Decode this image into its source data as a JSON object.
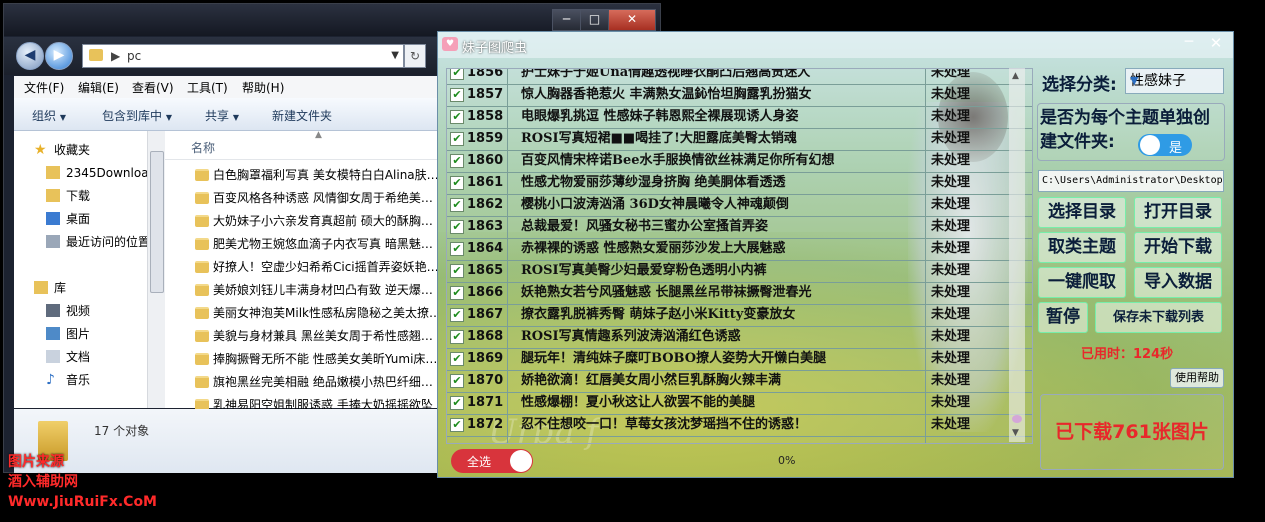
{
  "explorer": {
    "window_buttons": {
      "min": "─",
      "max": "□",
      "close": "✕"
    },
    "nav": {
      "back": "◀",
      "forward": "▶"
    },
    "address": {
      "path": "pc",
      "refresh": "↻"
    },
    "menu": [
      "文件(F)",
      "编辑(E)",
      "查看(V)",
      "工具(T)",
      "帮助(H)"
    ],
    "toolbar": [
      "组织",
      "包含到库中",
      "共享",
      "新建文件夹"
    ],
    "sidebar": [
      {
        "label": "收藏夹"
      },
      {
        "label": "2345Downloads"
      },
      {
        "label": "下载"
      },
      {
        "label": "桌面"
      },
      {
        "label": "最近访问的位置"
      },
      {
        "label": "库"
      },
      {
        "label": "视频"
      },
      {
        "label": "图片"
      },
      {
        "label": "文档"
      },
      {
        "label": "音乐"
      }
    ],
    "column_name": "名称",
    "files": [
      "白色胸罩福利写真 美女模特白白Alina肤…",
      "百变风格各种诱惑 风情御女周于希绝美…",
      "大奶妹子小六亲发育真超前 硕大的酥胸…",
      "肥美尤物王婉悠血滴子内衣写真 暗黑魅…",
      "好撩人！空虚少妇希希Cici摇首弄姿妖艳…",
      "美娇娘刘钰儿丰满身材凹凸有致 逆天爆…",
      "美丽女神泡芙Milk性感私房隐秘之美太撩…",
      "美貌与身材兼具 黑丝美女周于希性感翘…",
      "捧胸撅臀无所不能 性感美女美昕Yumi床…",
      "旗袍黑丝完美相融 绝品嫩模小热巴纤细…",
      "乳神易阳空姐制服诱惑 手捧大奶摇摇欲坠"
    ],
    "status": "17 个对象"
  },
  "crawler": {
    "title": "妹子图爬虫",
    "window_buttons": {
      "min": "─",
      "close": "✕"
    },
    "rows": [
      {
        "num": "1856",
        "title": "护士妹子于姬Una情趣透视睡衣酮凸后翘高贵迷人",
        "status": "未处理"
      },
      {
        "num": "1857",
        "title": "惊人胸器香艳惹火 丰满熟女温鈊怡坦胸露乳扮猫女",
        "status": "未处理"
      },
      {
        "num": "1858",
        "title": "电眼爆乳挑逗 性感妹子韩恩熙全裸展现诱人身姿",
        "status": "未处理"
      },
      {
        "num": "1859",
        "title": "ROSI写真短裙■■喝挂了!大胆露底美臀太销魂",
        "status": "未处理"
      },
      {
        "num": "1860",
        "title": "百变风情宋梓诺Bee水手服换情欲丝袜满足你所有幻想",
        "status": "未处理"
      },
      {
        "num": "1861",
        "title": "性感尤物爱丽莎薄纱湿身挤胸 绝美胴体看透透",
        "status": "未处理"
      },
      {
        "num": "1862",
        "title": "樱桃小口波涛汹涌 36D女神晨曦令人神魂颠倒",
        "status": "未处理"
      },
      {
        "num": "1863",
        "title": "总裁最爱！风骚女秘书三蜜办公室搔首弄姿",
        "status": "未处理"
      },
      {
        "num": "1864",
        "title": "赤裸裸的诱惑 性感熟女爱丽莎沙发上大展魅惑",
        "status": "未处理"
      },
      {
        "num": "1865",
        "title": "ROSI写真美臀少妇最爱穿粉色透明小内裤",
        "status": "未处理"
      },
      {
        "num": "1866",
        "title": "妖艳熟女若兮风骚魅惑 长腿黑丝吊带袜撅臀泄春光",
        "status": "未处理"
      },
      {
        "num": "1867",
        "title": "撩衣露乳脱裤秀臀 萌妹子赵小米Kitty变豪放女",
        "status": "未处理"
      },
      {
        "num": "1868",
        "title": "ROSI写真情趣系列波涛汹涌红色诱惑",
        "status": "未处理"
      },
      {
        "num": "1869",
        "title": "腿玩年！清纯妹子糜叮BOBO撩人姿势大开懒白美腿",
        "status": "未处理"
      },
      {
        "num": "1870",
        "title": "娇艳欲滴！红唇美女周小然巨乳酥胸火辣丰满",
        "status": "未处理"
      },
      {
        "num": "1871",
        "title": "性感爆棚！夏小秋这让人欲罢不能的美腿",
        "status": "未处理"
      },
      {
        "num": "1872",
        "title": "忍不住想咬一口！草莓女孩沈梦瑶挡不住的诱惑！",
        "status": "未处理"
      }
    ],
    "category_label": "选择分类:",
    "category_value": "性感妹子",
    "folder_question": "是否为每个主题单独创建文件夹:",
    "folder_toggle": "是",
    "path": "C:\\Users\\Administrator\\Desktop\\",
    "buttons": {
      "choose_dir": "选择目录",
      "open_dir": "打开目录",
      "get_topics": "取类主题",
      "start_download": "开始下载",
      "one_click": "一键爬取",
      "import_data": "导入数据",
      "pause": "暂停",
      "save_list": "保存未下载列表"
    },
    "elapsed": "已用时：124秒",
    "help": "使用帮助",
    "downloaded": "已下载761张图片",
    "select_all": "全选",
    "progress": "0%"
  },
  "watermark": [
    "图片来源",
    "酒入辅助网",
    "Www.JiuRuiFx.CoM"
  ]
}
